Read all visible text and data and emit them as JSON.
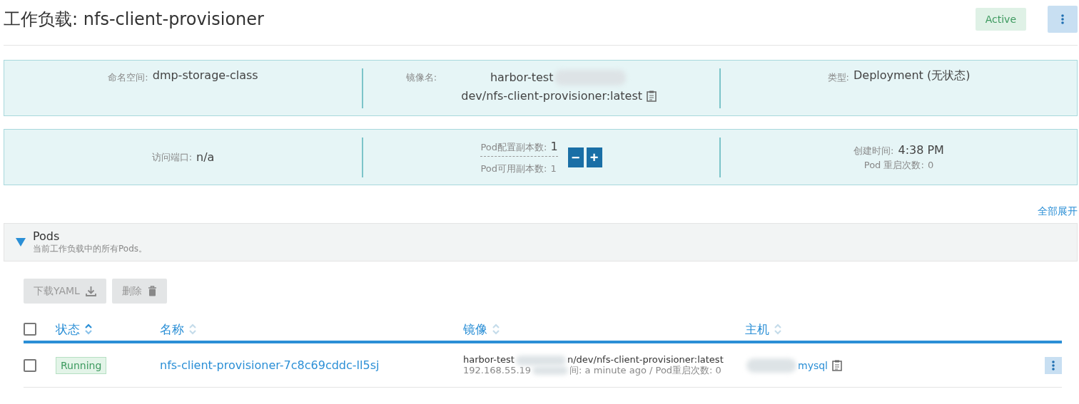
{
  "header": {
    "title_label": "工作负载:",
    "title_name": "nfs-client-provisioner",
    "status": "Active"
  },
  "info_top": [
    {
      "label": "命名空间:",
      "value": "dmp-storage-class",
      "kind": "text"
    },
    {
      "label": "镜像名:",
      "value_start": "harbor-test",
      "value_end": "dev/nfs-client-provisioner:latest",
      "kind": "image"
    },
    {
      "label": "类型:",
      "value": "Deployment (无状态)",
      "kind": "text"
    }
  ],
  "info_bottom": {
    "port": {
      "label": "访问端口:",
      "value": "n/a"
    },
    "replicas": {
      "configured_label": "Pod配置副本数:",
      "configured": "1",
      "available_label": "Pod可用副本数:",
      "available": "1",
      "minus": "−",
      "plus": "+"
    },
    "created": {
      "label": "创建时间:",
      "value": "4:38 PM",
      "restarts_label": "Pod 重启次数:",
      "restarts": "0"
    }
  },
  "expand_all": "全部展开",
  "pods": {
    "title": "Pods",
    "subtitle": "当前工作负载中的所有Pods。",
    "expanded": true,
    "select_all_checked": false,
    "buttons": [
      {
        "label": "下载YAML",
        "kind": "download",
        "disabled": true
      },
      {
        "label": "删除",
        "kind": "delete",
        "disabled": true
      }
    ],
    "columns": [
      {
        "label": "状态",
        "sorted": true
      },
      {
        "label": "名称",
        "sorted": false
      },
      {
        "label": "镜像",
        "sorted": false
      },
      {
        "label": "主机",
        "sorted": false
      }
    ],
    "rows": [
      {
        "checked": false,
        "status": "Running",
        "name": "nfs-client-provisioner-7c8c69cddc-ll5sj",
        "image_start": "harbor-test",
        "image_end": "n/dev/nfs-client-provisioner:latest",
        "ip": "192.168.55.19",
        "detail": "间: a minute ago / Pod重启次数: 0",
        "host": "mysql"
      }
    ]
  }
}
